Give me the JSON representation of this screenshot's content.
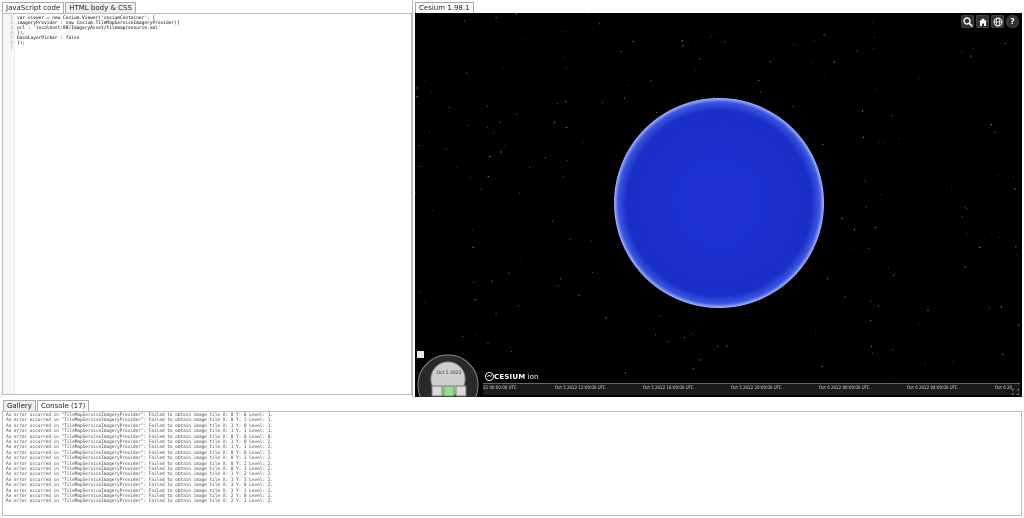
{
  "editor": {
    "tabs": [
      "JavaScript code",
      "HTML body & CSS"
    ],
    "lines": [
      "var viewer = new Cesium.Viewer('cesiumContainer', {",
      "imageryProvider : new Cesium.TileMapServiceImageryProvider({",
      "url : 'localhost:88/ImageryAsset/tilemapresource.xml'",
      "}),",
      "baseLayerPicker : false",
      "});",
      ""
    ]
  },
  "viewer": {
    "tab_label": "Cesium 1.98.1",
    "toolbar": [
      "search-icon",
      "home-icon",
      "globe-icon",
      "help-icon"
    ],
    "help_glyph": "?",
    "globe_color": "#1c2fd1",
    "logo_text": "CESIUM",
    "logo_suffix": "ion",
    "clock_date": "Oct 5 2022",
    "timeline_labels": [
      "22 00:00:00 UTC",
      "Oct 5 2022 12:00:00 UTC",
      "Oct 5 2022 16:00:00 UTC",
      "Oct 5 2022 20:00:00 UTC",
      "Oct 6 2022 00:00:00 UTC",
      "Oct 6 2022 04:00:00 UTC",
      "Oct 6 20"
    ]
  },
  "bottom": {
    "tabs": [
      "Gallery",
      "Console (17)"
    ],
    "console_lines": [
      "An error occurred in \"TileMapServiceImageryProvider\": Failed to obtain image tile X: 0 Y: 0 Level: 1.",
      "An error occurred in \"TileMapServiceImageryProvider\": Failed to obtain image tile X: 0 Y: 1 Level: 1.",
      "An error occurred in \"TileMapServiceImageryProvider\": Failed to obtain image tile X: 1 Y: 0 Level: 1.",
      "An error occurred in \"TileMapServiceImageryProvider\": Failed to obtain image tile X: 1 Y: 1 Level: 1.",
      "An error occurred in \"TileMapServiceImageryProvider\": Failed to obtain image tile X: 0 Y: 0 Level: 0.",
      "An error occurred in \"TileMapServiceImageryProvider\": Failed to obtain image tile X: 1 Y: 0 Level: 2.",
      "An error occurred in \"TileMapServiceImageryProvider\": Failed to obtain image tile X: 1 Y: 1 Level: 2.",
      "An error occurred in \"TileMapServiceImageryProvider\": Failed to obtain image tile X: 0 Y: 0 Level: 2.",
      "An error occurred in \"TileMapServiceImageryProvider\": Failed to obtain image tile X: 0 Y: 1 Level: 2.",
      "An error occurred in \"TileMapServiceImageryProvider\": Failed to obtain image tile X: 0 Y: 2 Level: 2.",
      "An error occurred in \"TileMapServiceImageryProvider\": Failed to obtain image tile X: 0 Y: 3 Level: 2.",
      "An error occurred in \"TileMapServiceImageryProvider\": Failed to obtain image tile X: 1 Y: 2 Level: 2.",
      "An error occurred in \"TileMapServiceImageryProvider\": Failed to obtain image tile X: 1 Y: 3 Level: 2.",
      "An error occurred in \"TileMapServiceImageryProvider\": Failed to obtain image tile X: 3 Y: 0 Level: 2.",
      "An error occurred in \"TileMapServiceImageryProvider\": Failed to obtain image tile X: 3 Y: 1 Level: 2.",
      "An error occurred in \"TileMapServiceImageryProvider\": Failed to obtain image tile X: 2 Y: 0 Level: 2.",
      "An error occurred in \"TileMapServiceImageryProvider\": Failed to obtain image tile X: 2 Y: 1 Level: 2."
    ]
  }
}
